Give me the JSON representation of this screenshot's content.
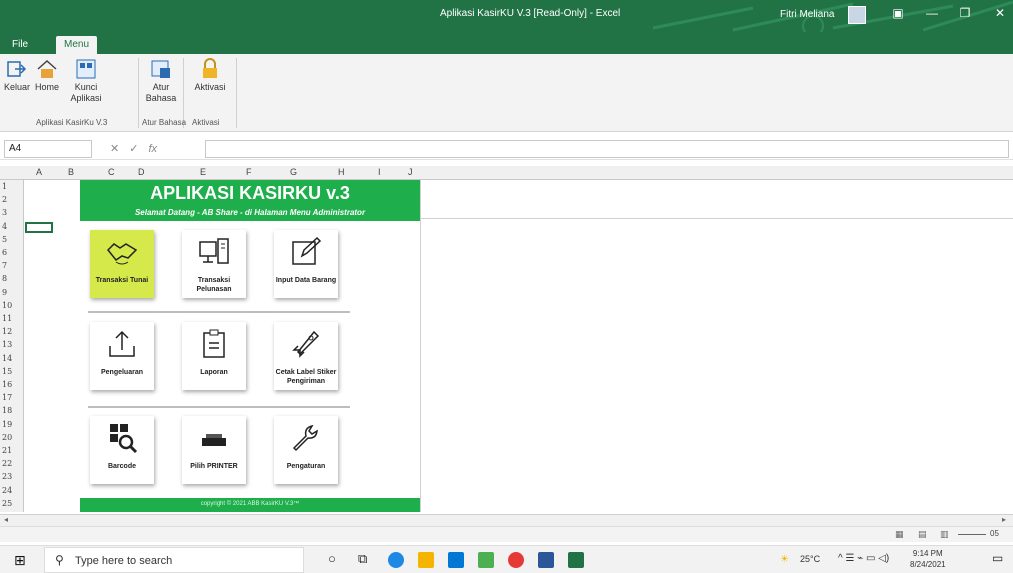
{
  "window": {
    "title": "Aplikasi KasirKU V.3  [Read-Only]  -  Excel",
    "user": "Fitri Meliana"
  },
  "tabs": {
    "file": "File",
    "menu": "Menu"
  },
  "ribbon": {
    "buttons": {
      "keluar": "Keluar",
      "home": "Home",
      "kunci": "Kunci Aplikasi",
      "atur": "Atur Bahasa",
      "aktivasi": "Aktivasi"
    },
    "groups": {
      "g1": "Aplikasi KasirKu V.3",
      "g2": "Atur Bahasa",
      "g3": "Aktivasi"
    }
  },
  "formula": {
    "namebox": "A4",
    "fx": "fx",
    "value": ""
  },
  "columns": [
    "A",
    "B",
    "C",
    "D",
    "E",
    "F",
    "G",
    "H",
    "I",
    "J"
  ],
  "rows": [
    "1",
    "2",
    "3",
    "4",
    "5",
    "6",
    "7",
    "8",
    "9",
    "10",
    "11",
    "12",
    "13",
    "14",
    "15",
    "16",
    "17",
    "18",
    "19",
    "20",
    "21",
    "22",
    "23",
    "24",
    "25"
  ],
  "app": {
    "title": "APLIKASI KASIRKU v.3",
    "subtitle": "Selamat Datang  - AB Share - di Halaman Menu Administrator",
    "footer": "copyright © 2021 ABB KasirKU V.3™",
    "tiles": {
      "transaksi_tunai": "Transaksi Tunai",
      "transaksi_pelunasan": "Transaksi Pelunasan",
      "input_data_barang": "Input Data Barang",
      "pengeluaran": "Pengeluaran",
      "laporan": "Laporan",
      "cetak_label": "Cetak Label Stiker Pengiriman",
      "barcode": "Barcode",
      "pilih_printer": "Pilih PRINTER",
      "pengaturan": "Pengaturan"
    }
  },
  "status": {
    "zoom": "05"
  },
  "taskbar": {
    "search": "Type here to search",
    "temp": "25°C",
    "time": "9:14 PM",
    "date": "8/24/2021"
  },
  "colors": {
    "excel_green": "#217346",
    "banner_green": "#1fae4c",
    "highlight": "#d5e94a"
  }
}
